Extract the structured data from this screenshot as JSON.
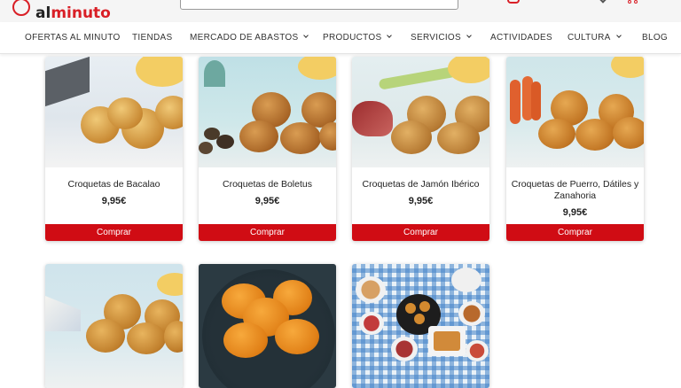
{
  "header": {
    "logo_text_prefix": "al",
    "logo_text_suffix": "minuto",
    "search_placeholder": ""
  },
  "nav": {
    "items": [
      {
        "label": "OFERTAS AL MINUTO",
        "dropdown": false
      },
      {
        "label": "TIENDAS",
        "dropdown": false
      },
      {
        "label": "MERCADO DE ABASTOS",
        "dropdown": true
      },
      {
        "label": "PRODUCTOS",
        "dropdown": true
      },
      {
        "label": "SERVICIOS",
        "dropdown": true
      },
      {
        "label": "ACTIVIDADES",
        "dropdown": false
      },
      {
        "label": "CULTURA",
        "dropdown": true
      },
      {
        "label": "BLOG",
        "dropdown": false
      }
    ]
  },
  "products": [
    {
      "title": "Croquetas de Bacalao",
      "price": "9,95€",
      "button": "Comprar"
    },
    {
      "title": "Croquetas de Boletus",
      "price": "9,95€",
      "button": "Comprar"
    },
    {
      "title": "Croquetas de Jamón Ibérico",
      "price": "9,95€",
      "button": "Comprar"
    },
    {
      "title": "Croquetas de Puerro, Dátiles y Zanahoria",
      "price": "9,95€",
      "button": "Comprar"
    },
    {
      "title": "",
      "price": "",
      "button": ""
    },
    {
      "title": "",
      "price": "",
      "button": ""
    },
    {
      "title": "",
      "price": "",
      "button": ""
    }
  ],
  "colors": {
    "brand": "#d91f26",
    "buy_button": "#d00c14"
  }
}
